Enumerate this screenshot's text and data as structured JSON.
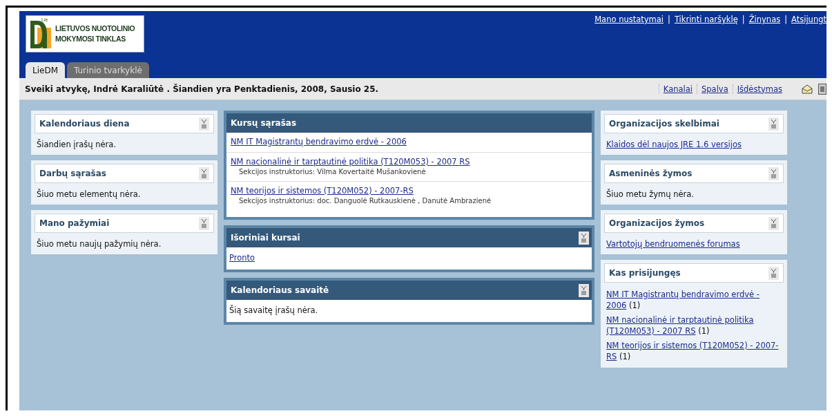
{
  "header": {
    "logo": {
      "superscript": "Lie",
      "line_1": "LIETUVOS NUOTOLINIO",
      "line_2": "MOKYMOSI TINKLAS"
    },
    "top_links": [
      "Mano nustatymai",
      "Tikrinti naršyklę",
      "Žinynas",
      "Atsijungt"
    ],
    "separator": "|",
    "tabs": [
      {
        "label": "LieDM",
        "selected": true
      },
      {
        "label": "Turinio tvarkyklė",
        "selected": false
      }
    ]
  },
  "welcome_bar": {
    "text": "Sveiki atvykę, Indrė Karaliūtė . Šiandien yra Penktadienis, 2008, Sausio 25.",
    "links": [
      "Kanalai",
      "Spalva",
      "Išdėstymas"
    ]
  },
  "columns": [
    {
      "portlets": [
        {
          "title": "Kalendoriaus diena",
          "collapsible": true,
          "items": [
            {
              "kind": "text",
              "text": "Šiandien įrašų nėra."
            }
          ]
        },
        {
          "title": "Darbų sąrašas",
          "collapsible": true,
          "items": [
            {
              "kind": "text",
              "text": "Šiuo metu elementų nėra."
            }
          ]
        },
        {
          "title": "Mano pažymiai",
          "collapsible": true,
          "items": [
            {
              "kind": "text",
              "text": "Šiuo metu naujų pažymių nėra."
            }
          ]
        }
      ]
    },
    {
      "portlets": [
        {
          "title": "Kursų sąrašas",
          "collapsible": false,
          "items": [
            {
              "kind": "course",
              "link": "NM IT Magistrantų bendravimo erdvė - 2006"
            },
            {
              "kind": "course",
              "link": "NM nacionalinė ir tarptautinė politika (T120M053) - 2007 RS",
              "note": "Sekcijos instruktorius: Vilma Kovertaitė Mušankovienė"
            },
            {
              "kind": "course",
              "link": "NM teorijos ir sistemos (T120M052) - 2007-RS",
              "note": "Sekcijos instruktorius: doc. Danguolė Rutkauskienė , Danutė Ambrazienė"
            }
          ]
        },
        {
          "title": "Išoriniai kursai",
          "collapsible": true,
          "items": [
            {
              "kind": "link",
              "text": "Pronto"
            }
          ]
        },
        {
          "title": "Kalendoriaus savaitė",
          "collapsible": true,
          "items": [
            {
              "kind": "text",
              "text": "Šią savaitę įrašų nėra."
            }
          ]
        }
      ]
    },
    {
      "portlets": [
        {
          "title": "Organizacijos skelbimai",
          "collapsible": true,
          "items": [
            {
              "kind": "link",
              "text": "Klaidos dėl naujos JRE 1.6 versijos"
            }
          ]
        },
        {
          "title": "Asmeninės žymos",
          "collapsible": true,
          "items": [
            {
              "kind": "text",
              "text": "Šiuo metu žymų nėra."
            }
          ]
        },
        {
          "title": "Organizacijos žymos",
          "collapsible": true,
          "items": [
            {
              "kind": "link",
              "text": "Vartotojų bendruomenės forumas"
            }
          ]
        },
        {
          "title": "Kas prisijungęs",
          "collapsible": true,
          "items": [
            {
              "kind": "online",
              "text": "NM IT Magistrantų bendravimo erdvė - 2006",
              "count": "(1)"
            },
            {
              "kind": "online",
              "text": "NM nacionalinė ir tarptautinė politika (T120M053) - 2007 RS",
              "count": "(1)"
            },
            {
              "kind": "online",
              "text": "NM teorijos ir sistemos (T120M052) - 2007-RS",
              "count": "(1)"
            }
          ]
        }
      ]
    }
  ]
}
